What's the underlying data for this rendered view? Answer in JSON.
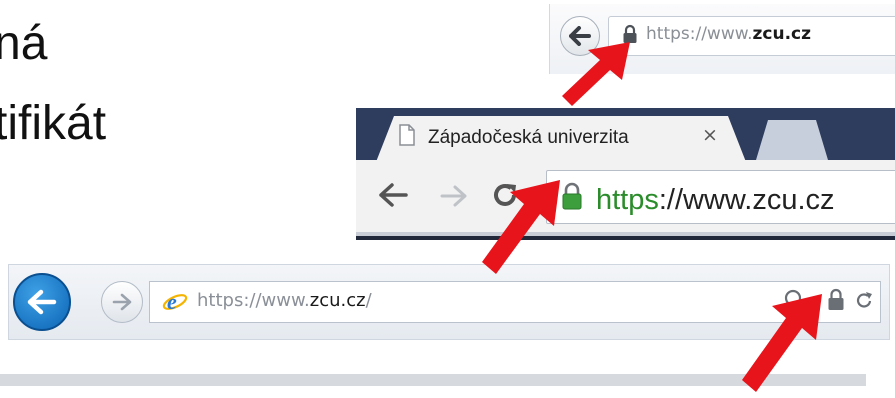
{
  "slide": {
    "line1": "ná",
    "line2": "tifikát"
  },
  "firefox": {
    "url_prefix": "https://www.",
    "url_host": "zcu.cz",
    "back_icon": "back-arrow-icon",
    "lock_icon": "padlock-icon"
  },
  "chrome": {
    "tab_title": "Západočeská univerzita",
    "tab_close": "×",
    "url_scheme": "https",
    "url_rest": "://www.zcu.cz",
    "lock_color": "#3c9e3c"
  },
  "ie": {
    "url_prefix": "https://www.",
    "url_host": "zcu.cz",
    "url_suffix": "/",
    "back_color": "#1a7fd0"
  },
  "annotation": {
    "arrow_color": "#e8141b"
  }
}
